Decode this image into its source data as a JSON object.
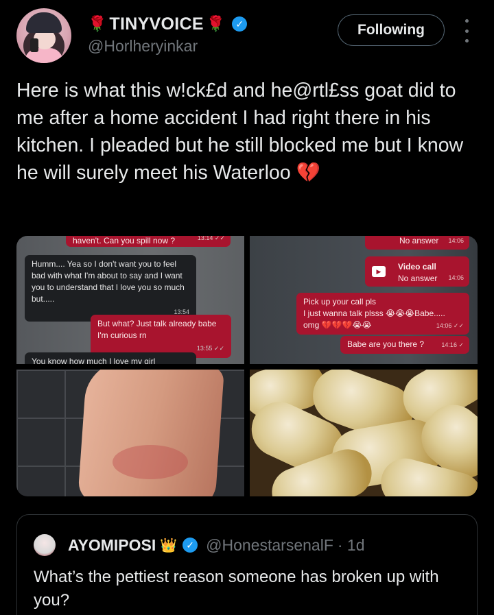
{
  "author": {
    "rose_emoji": "🌹",
    "display_name": "TINYVOICE",
    "handle": "@Horlheryinkar",
    "follow_label": "Following"
  },
  "tweet": {
    "text": "Here is what this w!ck£d and he@rtl£ss goat did to me after a home accident I had right there in his kitchen. I pleaded but he still blocked me but I know he will surely meet his Waterloo",
    "emoji": "💔"
  },
  "media": {
    "chat_left": {
      "top_partial": "haven't. Can you spill now ?",
      "top_partial_time": "13:14 ✓✓",
      "msg1": "Humm.... Yea so I don't want you to feel bad with what I'm about to say and I want you to understand that I love you so much but.....",
      "msg1_time": "13:54",
      "msg2": "But what? Just talk already babe I'm curious rn",
      "msg2_time": "13:55 ✓✓",
      "bottom_partial": "You know how much I love my girl"
    },
    "chat_right": {
      "no_answer_1": "No answer",
      "no_answer_1_time": "14:06",
      "video_call": "Video call",
      "no_answer_2": "No answer",
      "no_answer_2_time": "14:06",
      "msg_pick_up": "Pick up your call pls",
      "msg_talk": "I just wanna talk plsss 😭😭😭Babe.....",
      "msg_omg": "omg 💔💔💔😭😭",
      "msg_pick_up_time": "14:06 ✓✓",
      "msg_there": "Babe are you there ?",
      "msg_there_time": "14:16 ✓"
    }
  },
  "quoted": {
    "display_name": "AYOMIPOSI",
    "crown_emoji": "👑",
    "handle": "@HonestarsenalF",
    "time": "· 1d",
    "text": "What’s the pettiest reason someone has broken up with you?"
  }
}
